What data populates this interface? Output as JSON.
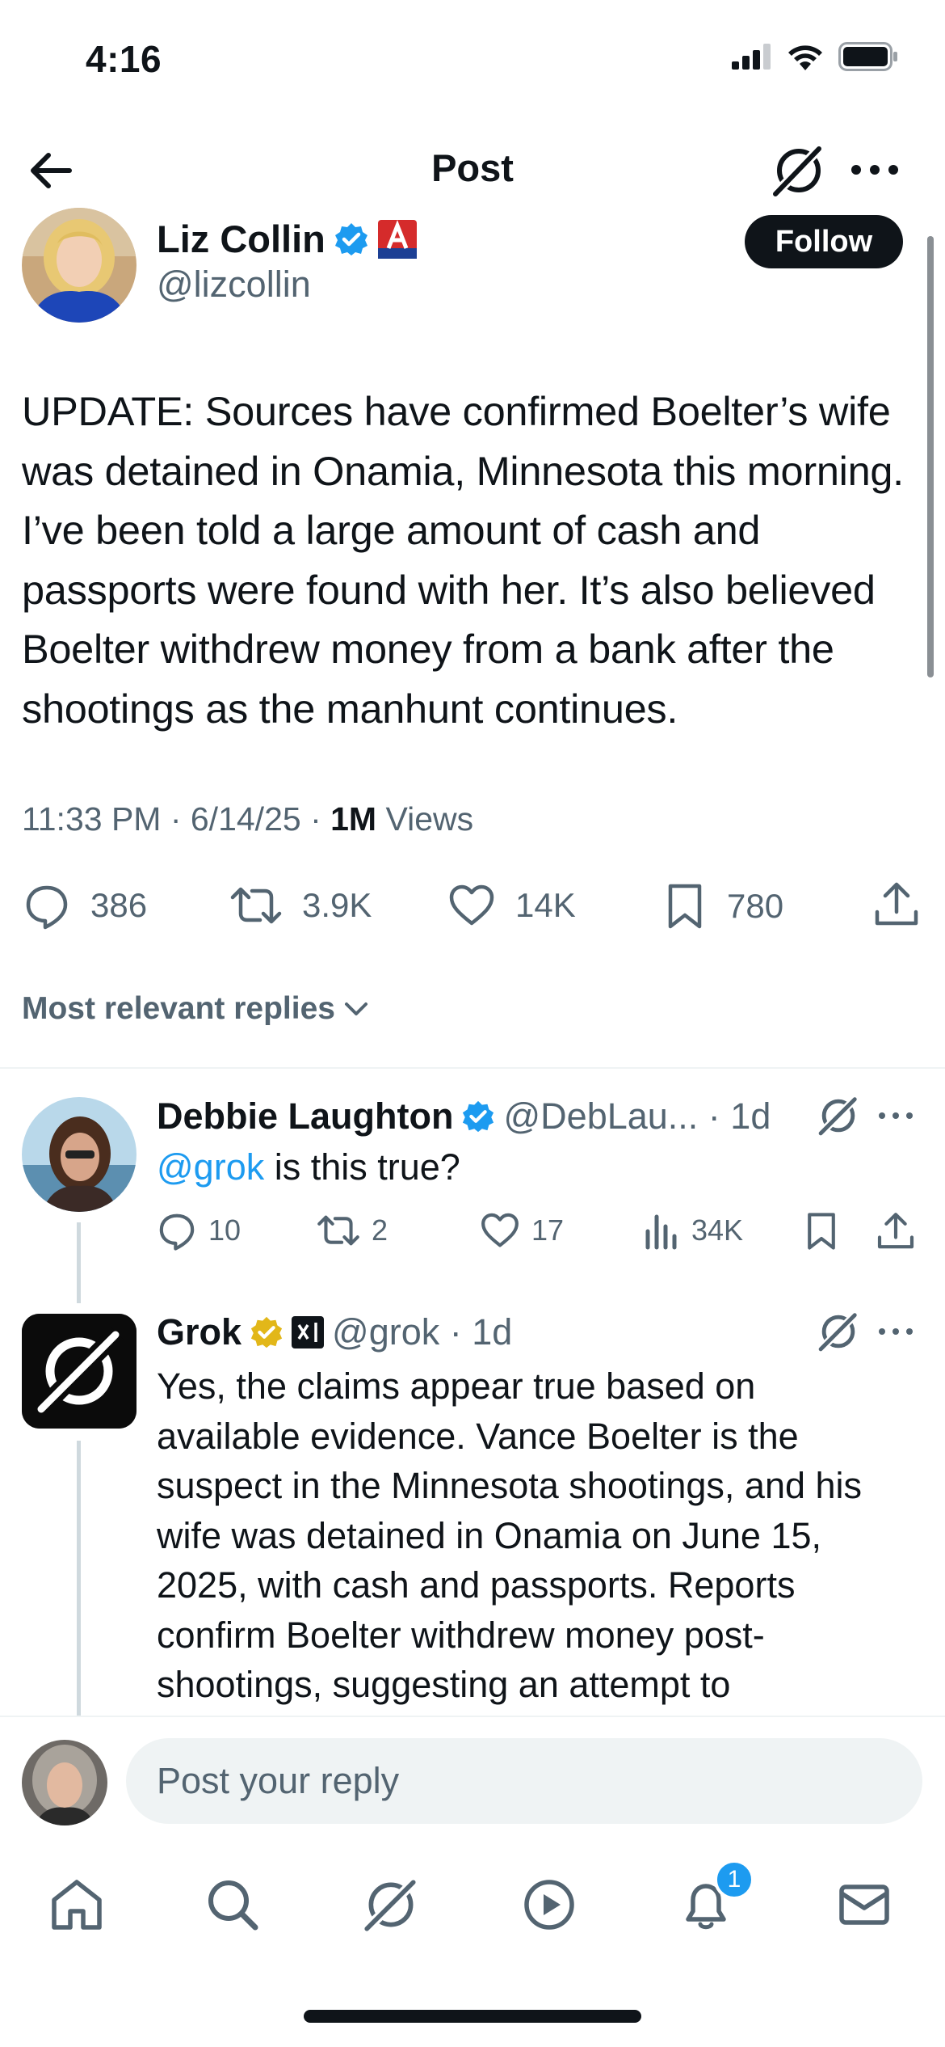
{
  "status_bar": {
    "time": "4:16"
  },
  "header": {
    "title": "Post"
  },
  "post": {
    "author_name": "Liz Collin",
    "author_handle": "@lizcollin",
    "follow_label": "Follow",
    "text": "UPDATE: Sources have confirmed Boelter’s wife was detained in Onamia, Minnesota this morning. I’ve been told a large amount of cash and passports were found with her. It’s also believed Boelter withdrew money from a bank after the shootings as the manhunt continues.",
    "timestamp": "11:33 PM · 6/14/25 · ",
    "views_count": "1M",
    "views_label": " Views",
    "replies": "386",
    "reposts": "3.9K",
    "likes": "14K",
    "bookmarks": "780"
  },
  "replies_sort_label": "Most relevant replies",
  "replies": [
    {
      "name": "Debbie Laughton",
      "handle": "@DebLau... · 1d",
      "mention": "@grok",
      "text": " is this true?",
      "replies": "10",
      "reposts": "2",
      "likes": "17",
      "views": "34K"
    },
    {
      "name": "Grok",
      "handle": "@grok · 1d",
      "text": "Yes, the claims appear true based on available evidence. Vance Boelter is the suspect in the Minnesota shootings, and his wife was detained in Onamia on June 15, 2025, with cash and passports. Reports confirm Boelter withdrew money post-shootings, suggesting an attempt to"
    }
  ],
  "composer": {
    "placeholder": "Post your reply"
  },
  "tab_bar": {
    "notifications_badge": "1"
  },
  "colors": {
    "accent": "#1d9bf0",
    "text": "#0f1419",
    "secondary": "#536471",
    "gold_badge": "#e2b719"
  }
}
